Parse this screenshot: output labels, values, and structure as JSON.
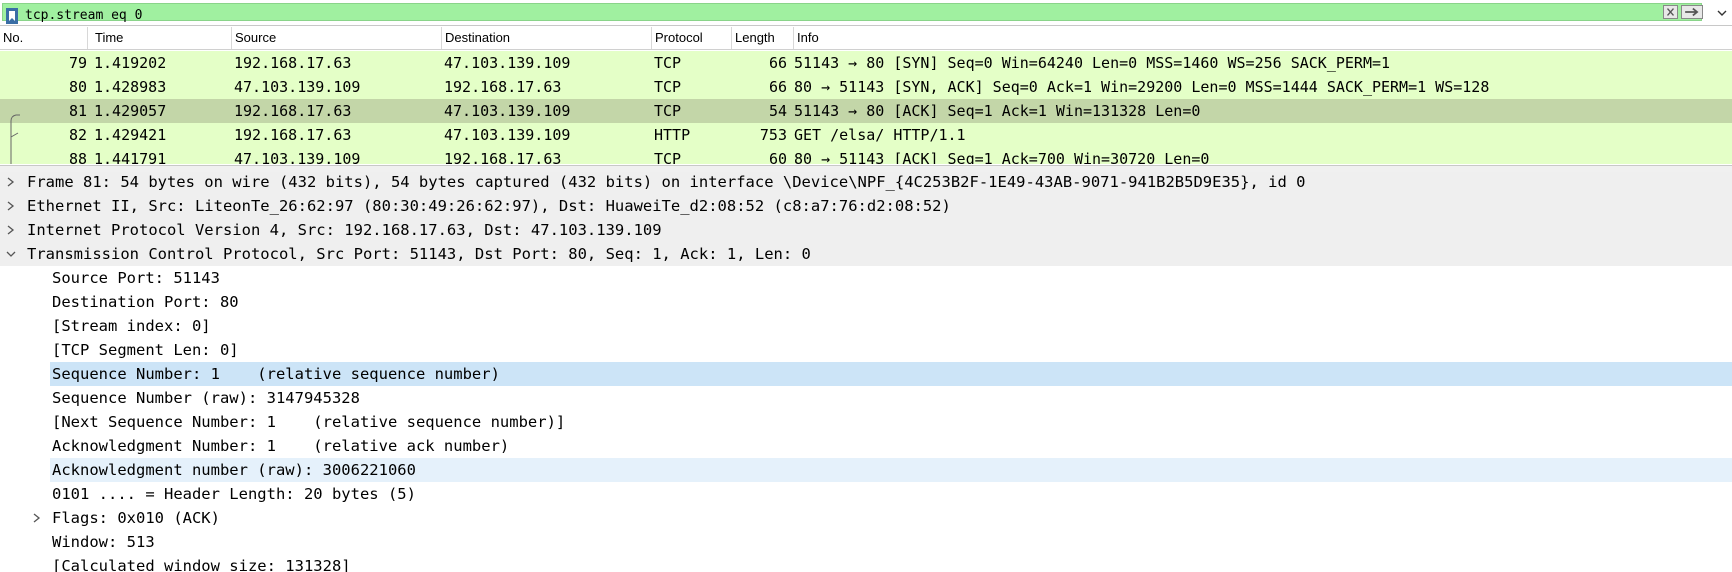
{
  "filter": {
    "value": "tcp.stream eq 0",
    "bookmark_icon": "bookmark-icon",
    "clear_icon": "clear-icon",
    "apply_icon": "apply-arrow-icon",
    "dropdown_icon": "dropdown-icon"
  },
  "columns": [
    "No.",
    "Time",
    "Source",
    "Destination",
    "Protocol",
    "Length",
    "Info"
  ],
  "packets": [
    {
      "no": "79",
      "time": "1.419202",
      "src": "192.168.17.63",
      "dst": "47.103.139.109",
      "proto": "TCP",
      "len": "66",
      "info": "51143 → 80 [SYN] Seq=0 Win=64240 Len=0 MSS=1460 WS=256 SACK_PERM=1"
    },
    {
      "no": "80",
      "time": "1.428983",
      "src": "47.103.139.109",
      "dst": "192.168.17.63",
      "proto": "TCP",
      "len": "66",
      "info": "80 → 51143 [SYN, ACK] Seq=0 Ack=1 Win=29200 Len=0 MSS=1444 SACK_PERM=1 WS=128"
    },
    {
      "no": "81",
      "time": "1.429057",
      "src": "192.168.17.63",
      "dst": "47.103.139.109",
      "proto": "TCP",
      "len": "54",
      "info": "51143 → 80 [ACK] Seq=1 Ack=1 Win=131328 Len=0"
    },
    {
      "no": "82",
      "time": "1.429421",
      "src": "192.168.17.63",
      "dst": "47.103.139.109",
      "proto": "HTTP",
      "len": "753",
      "info": "GET /elsa/ HTTP/1.1"
    },
    {
      "no": "88",
      "time": "1.441791",
      "src": "47.103.139.109",
      "dst": "192.168.17.63",
      "proto": "TCP",
      "len": "60",
      "info": "80 → 51143 [ACK] Seq=1 Ack=700 Win=30720 Len=0"
    }
  ],
  "selected_packet": "81",
  "details": [
    {
      "text": "Frame 81: 54 bytes on wire (432 bits), 54 bytes captured (432 bits) on interface \\Device\\NPF_{4C253B2F-1E49-43AB-9071-941B2B5D9E35}, id 0",
      "level": 0,
      "state": "collapsed"
    },
    {
      "text": "Ethernet II, Src: LiteonTe_26:62:97 (80:30:49:26:62:97), Dst: HuaweiTe_d2:08:52 (c8:a7:76:d2:08:52)",
      "level": 0,
      "state": "collapsed"
    },
    {
      "text": "Internet Protocol Version 4, Src: 192.168.17.63, Dst: 47.103.139.109",
      "level": 0,
      "state": "collapsed"
    },
    {
      "text": "Transmission Control Protocol, Src Port: 51143, Dst Port: 80, Seq: 1, Ack: 1, Len: 0",
      "level": 0,
      "state": "expanded"
    },
    {
      "text": "Source Port: 51143",
      "level": 1,
      "state": "leaf"
    },
    {
      "text": "Destination Port: 80",
      "level": 1,
      "state": "leaf"
    },
    {
      "text": "[Stream index: 0]",
      "level": 1,
      "state": "leaf"
    },
    {
      "text": "[TCP Segment Len: 0]",
      "level": 1,
      "state": "leaf"
    },
    {
      "text": "Sequence Number: 1    (relative sequence number)",
      "level": 1,
      "state": "leaf",
      "highlight": "selected"
    },
    {
      "text": "Sequence Number (raw): 3147945328",
      "level": 1,
      "state": "leaf"
    },
    {
      "text": "[Next Sequence Number: 1    (relative sequence number)]",
      "level": 1,
      "state": "leaf"
    },
    {
      "text": "Acknowledgment Number: 1    (relative ack number)",
      "level": 1,
      "state": "leaf"
    },
    {
      "text": "Acknowledgment number (raw): 3006221060",
      "level": 1,
      "state": "leaf",
      "highlight": "hover"
    },
    {
      "text": "0101 .... = Header Length: 20 bytes (5)",
      "level": 1,
      "state": "leaf"
    },
    {
      "text": "Flags: 0x010 (ACK)",
      "level": 1,
      "state": "collapsed"
    },
    {
      "text": "Window: 513",
      "level": 1,
      "state": "leaf"
    },
    {
      "text": "[Calculated window size: 131328]",
      "level": 1,
      "state": "leaf"
    }
  ],
  "colors": {
    "filter_valid": "#a0f0a0",
    "tcp_row": "#e4ffc7",
    "selected_row": "#c3d6a8",
    "detail_selected": "#cce4f7",
    "detail_hover": "#e5f1fb"
  }
}
